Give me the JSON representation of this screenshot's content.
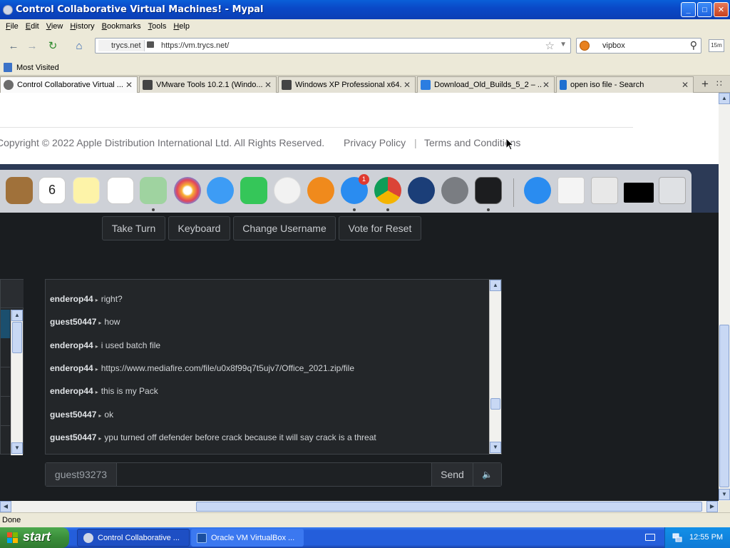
{
  "window": {
    "title": "Control Collaborative Virtual Machines! - Mypal",
    "buttons": {
      "minimize": "_",
      "maximize": "□",
      "close": "✕"
    }
  },
  "menu": [
    "File",
    "Edit",
    "View",
    "History",
    "Bookmarks",
    "Tools",
    "Help"
  ],
  "nav": {
    "site_label": "trycs.net",
    "url": "https://vm.trycs.net/",
    "search_value": "vipbox",
    "ext_label": "15m"
  },
  "bookmarks": {
    "most_visited": "Most Visited"
  },
  "tabs": [
    {
      "label": "Control Collaborative Virtual ...",
      "favicon_color": "#6c6c6c",
      "active": true
    },
    {
      "label": "VMware Tools 10.2.1 (Windo...",
      "favicon_color": "#444444",
      "active": false
    },
    {
      "label": "Windows XP Professional x64...",
      "favicon_color": "#444444",
      "active": false
    },
    {
      "label": "Download_Old_Builds_5_2 – ...",
      "favicon_color": "#2b7de1",
      "active": false
    },
    {
      "label": "open iso file - Search",
      "favicon_color": "#1f6fd0",
      "active": false
    }
  ],
  "page": {
    "copyright": "Copyright © 2022 Apple Distribution International Ltd. All Rights Reserved.",
    "privacy": "Privacy Policy",
    "separator": "|",
    "terms": "Terms and Conditions",
    "dock_badge": "1",
    "calendar_day": "6",
    "buttons": {
      "take_turn": "Take Turn",
      "keyboard": "Keyboard",
      "change_username": "Change Username",
      "vote_reset": "Vote for Reset"
    },
    "chat": [
      {
        "user": "enderop44",
        "text": "right?"
      },
      {
        "user": "guest50447",
        "text": "how"
      },
      {
        "user": "enderop44",
        "text": "i used batch file"
      },
      {
        "user": "enderop44",
        "text": "https://www.mediafire.com/file/u0x8f99q7t5ujv7/Office_2021.zip/file"
      },
      {
        "user": "enderop44",
        "text": "this is my Pack"
      },
      {
        "user": "guest50447",
        "text": "ok"
      },
      {
        "user": "guest50447",
        "text": "ypu turned off defender before crack because it will say crack is a threat"
      }
    ],
    "input": {
      "username": "guest93273",
      "send": "Send"
    }
  },
  "status": {
    "text": "Done"
  },
  "taskbar": {
    "start": "start",
    "tasks": [
      "Control Collaborative ...",
      "Oracle VM VirtualBox ..."
    ],
    "clock": "12:55 PM"
  },
  "colors": {
    "titlebar": "#0a49c8",
    "chat_bg": "#232629",
    "page_dark": "#1a1d20",
    "taskbar": "#245edb",
    "start_green": "#3a8e3a"
  }
}
